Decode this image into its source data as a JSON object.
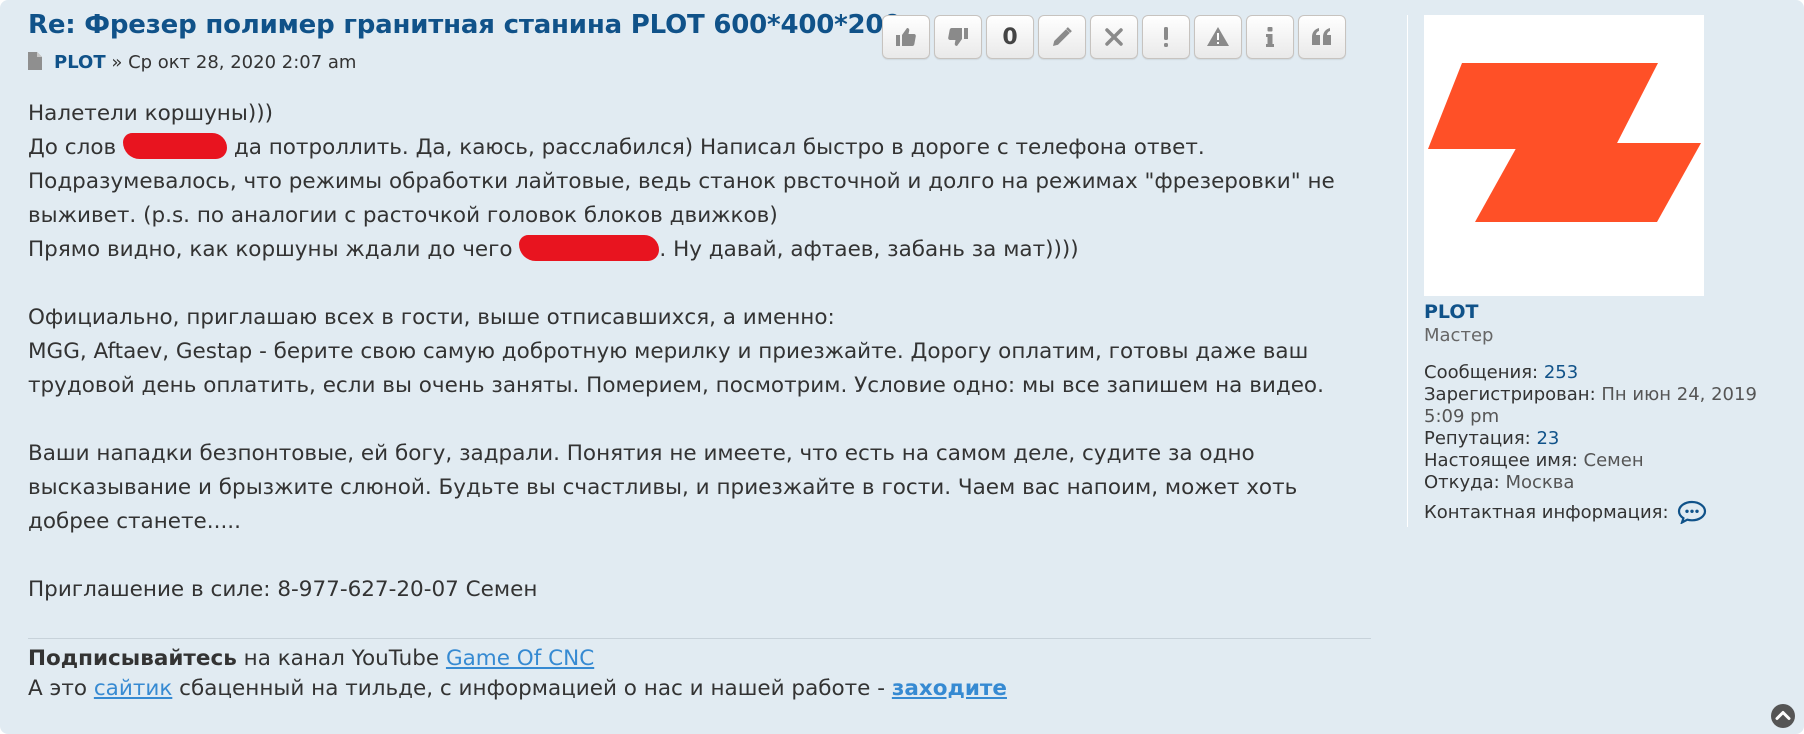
{
  "post": {
    "title": "Re: Фрезер полимер гранитная станина PLOT 600*400*200",
    "author": "PLOT",
    "date_sep": " » ",
    "date": "Ср окт 28, 2020 2:07 am",
    "vote_count": "0"
  },
  "content": {
    "p1": {
      "l1": "Налетели коршуны)))",
      "l2a": "До слов ",
      "l2b": " да потроллить. Да, каюсь, расслабился) Написал быстро в дороге с телефона ответ.",
      "l3": "Подразумевалось, что режимы обработки лайтовые, ведь станок рвсточной и долго на режимах \"фрезеровки\" не",
      "l4": "выживет. (p.s. по аналогии с расточкой головок блоков движков)",
      "l5a": "Прямо видно, как коршуны ждали до чего ",
      "l5b": ". Ну давай, афтаев, забань за мат))))"
    },
    "p2": {
      "l1": "Официально, приглашаю всех в гости, выше отписавшихся, а именно:",
      "l2": "MGG, Aftaev, Gestap - берите свою самую добротную мерилку и приезжайте. Дорогу оплатим, готовы даже ваш",
      "l3": "трудовой день оплатить, если вы очень заняты. Померием, посмотрим. Условие одно: мы все запишем на видео."
    },
    "p3": {
      "l1": "Ваши нападки безпонтовые, ей богу, задрали. Понятия не имеете, что есть на самом деле, судите за одно",
      "l2": "высказывание и брызжите слюной. Будьте вы счастливы, и приезжайте в гости. Чаем вас напоим, может хоть",
      "l3": "добрее станете....."
    },
    "p4": {
      "l1": "Приглашение в силе: 8-977-627-20-07 Семен"
    }
  },
  "signature": {
    "l1_bold": "Подписывайтесь",
    "l1_text": " на канал YouTube ",
    "l1_link": "Game Of CNC",
    "l2_text1": "А это ",
    "l2_link": "сайтик",
    "l2_text2": " сбаценный на тильде, с информацией о нас и нашей работе - ",
    "l2_link2": "заходите"
  },
  "profile": {
    "username": "PLOT",
    "rank": "Мастер",
    "posts_label": "Сообщения:",
    "posts_value": "253",
    "registered_label": "Зарегистрирован:",
    "registered_value_1": "Пн июн 24, 2019",
    "registered_value_2": "5:09 pm",
    "reputation_label": "Репутация:",
    "reputation_value": "23",
    "realname_label": "Настоящее имя:",
    "realname_value": "Семен",
    "from_label": "Откуда:",
    "from_value": "Москва",
    "contact_label": "Контактная информация:"
  },
  "icons": {
    "buttons": [
      "thumbs-up-icon",
      "thumbs-down-icon",
      "vote-count",
      "edit-icon",
      "delete-icon",
      "report-icon",
      "warn-icon",
      "info-icon",
      "quote-icon"
    ]
  },
  "colors": {
    "title": "#105289",
    "link": "#368ad2",
    "background": "#e1ebf2",
    "logo": "#ff5027",
    "redaction": "#e8141f"
  }
}
